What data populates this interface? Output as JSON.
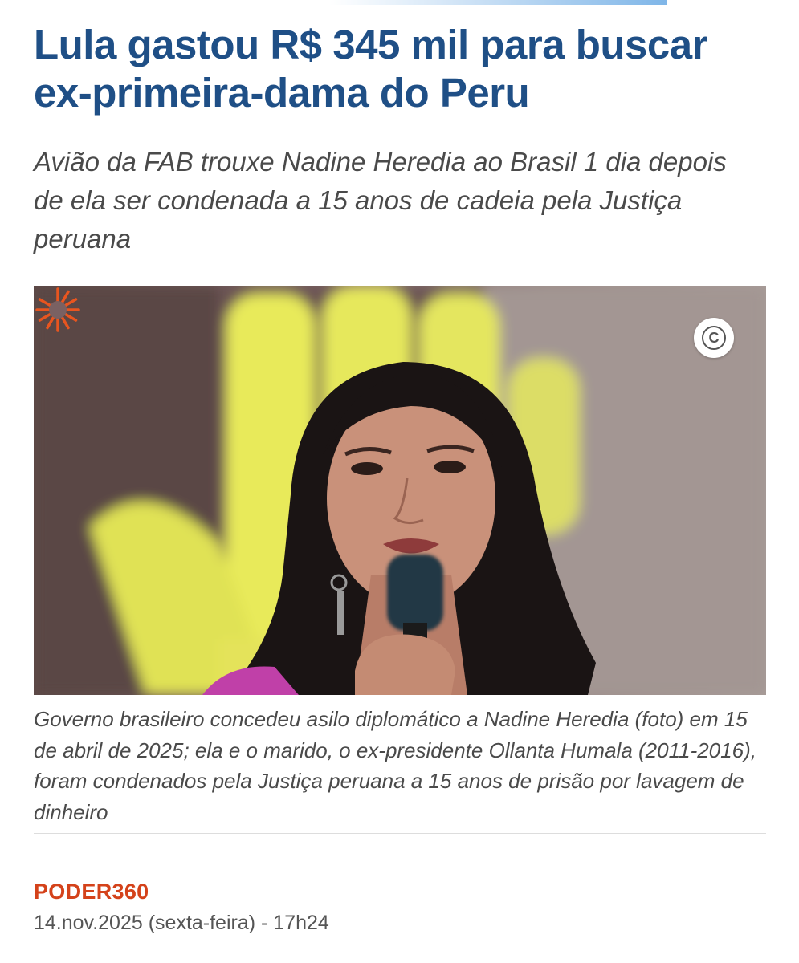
{
  "article": {
    "headline": "Lula gastou R$ 345 mil para buscar ex-primeira-dama do Peru",
    "subheadline": "Avião da FAB trouxe Nadine Heredia ao Brasil 1 dia depois de ela ser condenada a 15 anos de cadeia pela Justiça peruana",
    "photo": {
      "logo_icon": "poder360-sunburst-icon",
      "copyright_icon": "copyright-icon",
      "copyright_symbol": "C"
    },
    "caption": "Governo brasileiro concedeu asilo diplomático a Nadine Heredia (foto) em 15 de abril de 2025; ela e o marido, o ex-presidente Ollanta Humala (2011-2016), foram condenados pela Justiça peruana a 15 anos de prisão por lavagem de dinheiro",
    "source": "PODER360",
    "date": "14.nov.2025 (sexta-feira) - 17h24"
  },
  "colors": {
    "headline": "#1f4f86",
    "source_brand": "#d4421a",
    "text_gray": "#4a4a4a",
    "logo_orange": "#e8551f"
  }
}
